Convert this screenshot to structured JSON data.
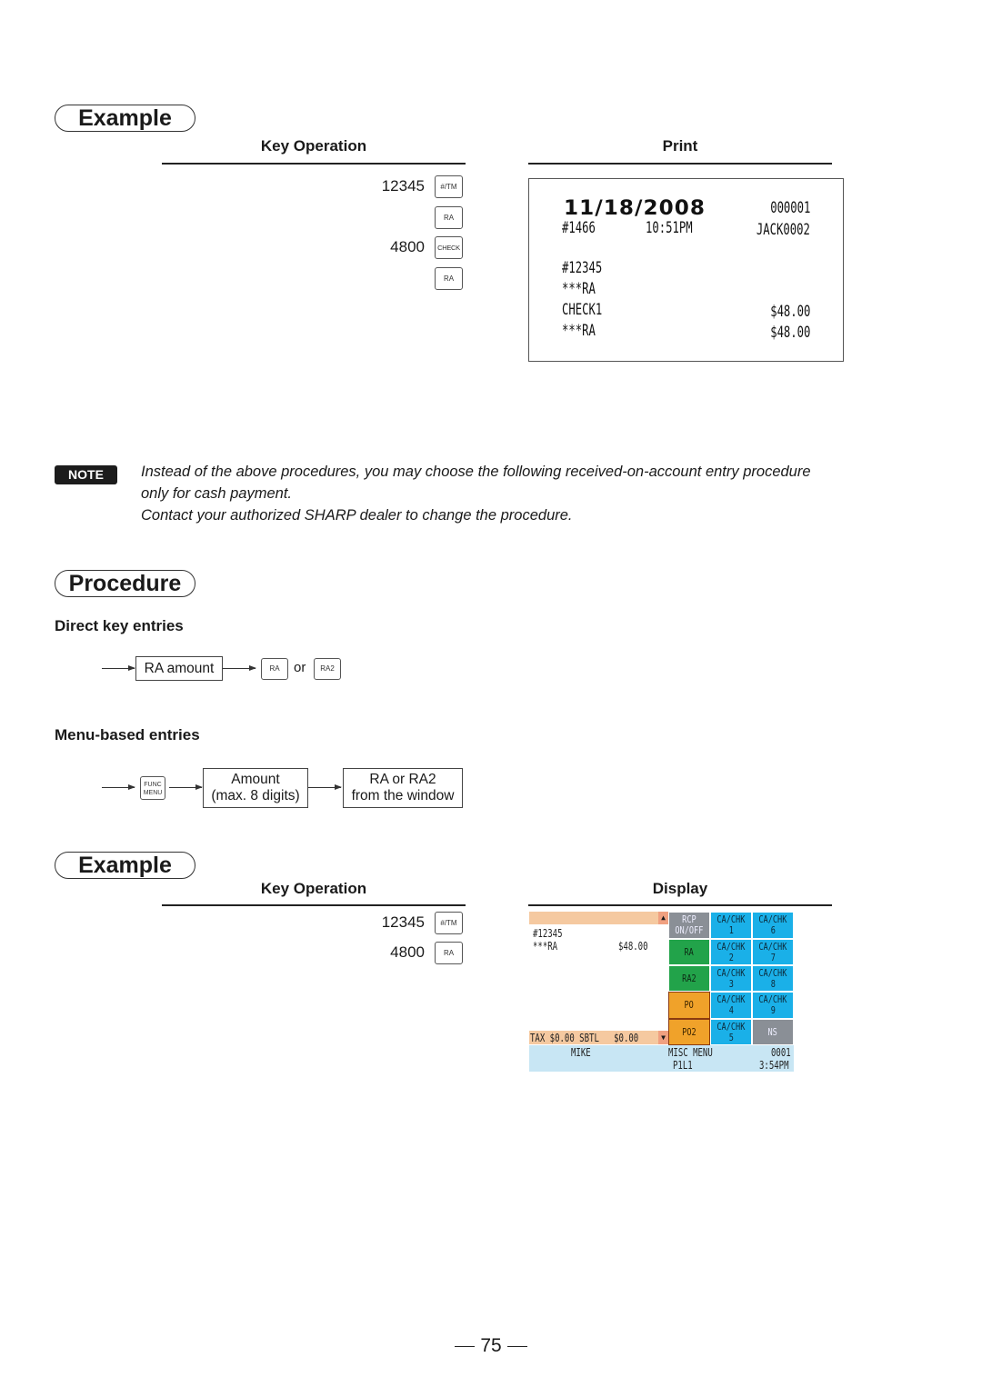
{
  "example1": {
    "title": "Example",
    "key_operation_heading": "Key Operation",
    "print_heading": "Print",
    "steps": [
      {
        "value": "12345",
        "key": "#/TM"
      },
      {
        "value": "",
        "key": "RA"
      },
      {
        "value": "4800",
        "key": "CHECK"
      },
      {
        "value": "",
        "key": "RA"
      }
    ],
    "receipt": {
      "date": "11/18/2008",
      "consecutive_no": "000001",
      "receipt_no": "#1466",
      "time": "10:51PM",
      "clerk": "JACK0002",
      "lines": [
        {
          "label": "#12345",
          "amount": ""
        },
        {
          "label": "***RA",
          "amount": ""
        },
        {
          "label": "CHECK1",
          "amount": "$48.00"
        },
        {
          "label": "***RA",
          "amount": "$48.00"
        }
      ]
    }
  },
  "note": {
    "badge": "NOTE",
    "line1": "Instead of the above procedures, you may choose the following received-on-account entry procedure",
    "line2": "only for cash payment.",
    "line3": "Contact your authorized SHARP dealer to change the procedure."
  },
  "procedure": {
    "title": "Procedure",
    "direct": {
      "heading": "Direct key entries",
      "box": "RA amount",
      "key1": "RA",
      "or": "or",
      "key2": "RA2"
    },
    "menu": {
      "heading": "Menu-based entries",
      "key_line1": "FUNC",
      "key_line2": "MENU",
      "box1_line1": "Amount",
      "box1_line2": "(max. 8 digits)",
      "box2_line1": "RA or RA2",
      "box2_line2": "from the window"
    }
  },
  "example2": {
    "title": "Example",
    "key_operation_heading": "Key Operation",
    "display_heading": "Display",
    "steps": [
      {
        "value": "12345",
        "key": "#/TM"
      },
      {
        "value": "4800",
        "key": "RA"
      }
    ],
    "display": {
      "line1_label": "#12345",
      "line2_label": "***RA",
      "line2_amount": "$48.00",
      "tax_bar": "TAX $0.00 SBTL   $0.00",
      "buttons": {
        "rcp": [
          "RCP",
          "ON/OFF"
        ],
        "ra": "RA",
        "ra2": "RA2",
        "po": "PO",
        "po2": "PO2",
        "ns": "NS",
        "cachk": [
          [
            "CA/CHK",
            "1"
          ],
          [
            "CA/CHK",
            "2"
          ],
          [
            "CA/CHK",
            "3"
          ],
          [
            "CA/CHK",
            "4"
          ],
          [
            "CA/CHK",
            "5"
          ],
          [
            "CA/CHK",
            "6"
          ],
          [
            "CA/CHK",
            "7"
          ],
          [
            "CA/CHK",
            "8"
          ],
          [
            "CA/CHK",
            "9"
          ]
        ]
      },
      "status": {
        "clerk": "MIKE",
        "mode": "MISC MENU",
        "number": "0001",
        "position": "P1L1",
        "time": "3:54PM"
      },
      "colors": {
        "top_bar": "#f5c9a0",
        "scroll_arrow_bg": "#f0a080",
        "status_bar": "#c8e6f4",
        "ca_chk": "#1ab0e8",
        "ra_green": "#22a34a",
        "po_orange": "#f0a22a",
        "gray": "#8a8f96"
      }
    }
  },
  "page_number": "75"
}
